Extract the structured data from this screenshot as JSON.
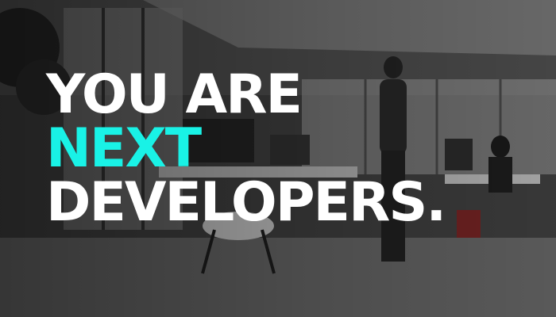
{
  "headline": {
    "line1": "YOU ARE",
    "line2": "NEXT",
    "line3": "DEVELOPERS."
  },
  "colors": {
    "text": "#ffffff",
    "accent": "#19f2e6",
    "scene_tone": "grayscale"
  }
}
